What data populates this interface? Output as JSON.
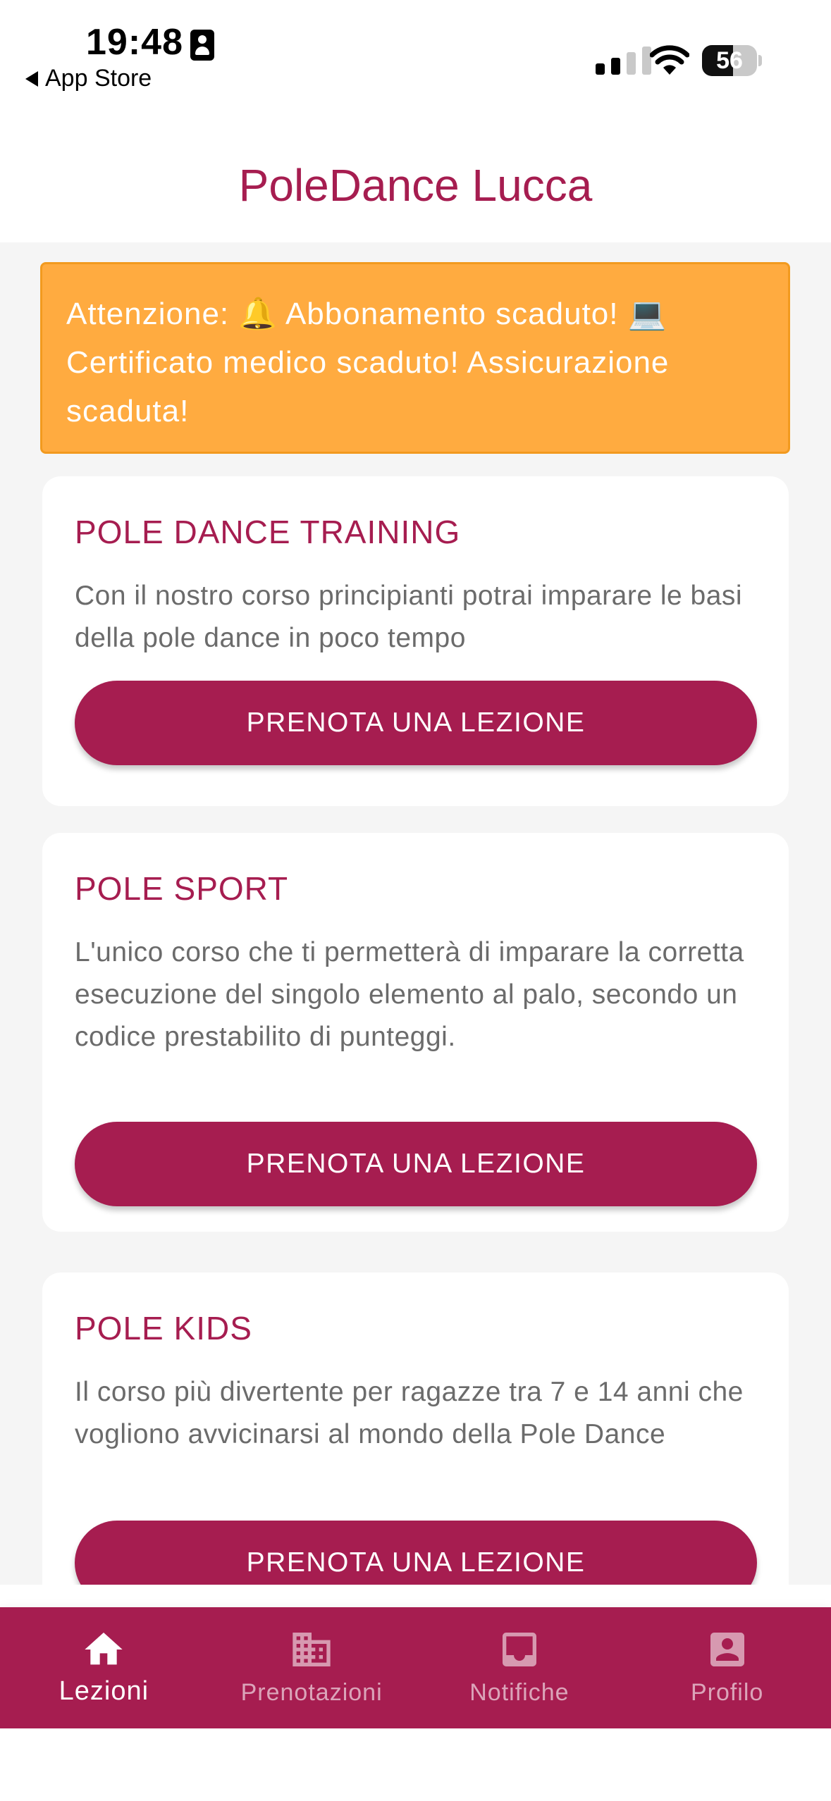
{
  "status_bar": {
    "time": "19:48",
    "back_label": "App Store",
    "battery": "56",
    "battery_level": 0.56
  },
  "header": {
    "title": "PoleDance Lucca"
  },
  "alert": {
    "text": "Attenzione: 🔔 Abbonamento scaduto! 💻 Certificato medico scaduto! Assicurazione scaduta!"
  },
  "courses": [
    {
      "title": "POLE DANCE TRAINING",
      "description": "Con il nostro corso principianti potrai imparare le basi della pole dance in poco tempo",
      "button_label": "PRENOTA UNA LEZIONE"
    },
    {
      "title": "POLE SPORT",
      "description": "L'unico corso che ti permetterà di imparare la corretta esecuzione del singolo elemento al palo, secondo un codice prestabilito di punteggi.",
      "button_label": "PRENOTA UNA LEZIONE"
    },
    {
      "title": "POLE KIDS",
      "description": "Il corso più divertente per ragazze tra 7 e 14 anni che vogliono avvicinarsi al mondo della Pole Dance",
      "button_label": "PRENOTA UNA LEZIONE"
    }
  ],
  "bottom_nav": {
    "items": [
      {
        "label": "Lezioni",
        "icon": "home-icon",
        "active": true
      },
      {
        "label": "Prenotazioni",
        "icon": "building-icon",
        "active": false
      },
      {
        "label": "Notifiche",
        "icon": "inbox-icon",
        "active": false
      },
      {
        "label": "Profilo",
        "icon": "account-box-icon",
        "active": false
      }
    ]
  },
  "colors": {
    "brand": "#a61d50",
    "alert_bg": "#ffab40",
    "background": "#f5f5f5"
  }
}
